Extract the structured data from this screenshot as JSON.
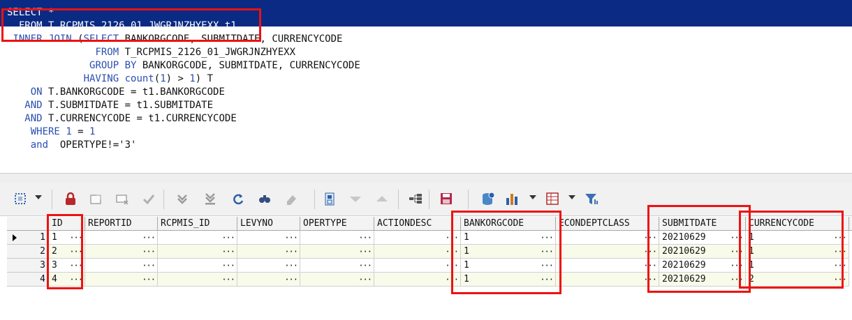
{
  "editor": {
    "lines": [
      "SELECT *",
      "  FROM T_RCPMIS_2126_01_JWGRJNZHYEXX t1",
      " INNER JOIN (SELECT BANKORGCODE, SUBMITDATE, CURRENCYCODE",
      "               FROM T_RCPMIS_2126_01_JWGRJNZHYEXX",
      "              GROUP BY BANKORGCODE, SUBMITDATE, CURRENCYCODE",
      "             HAVING count(1) > 1) T",
      "    ON T.BANKORGCODE = t1.BANKORGCODE",
      "   AND T.SUBMITDATE = t1.SUBMITDATE",
      "   AND T.CURRENCYCODE = t1.CURRENCYCODE",
      "    WHERE 1 = 1",
      "    and  OPERTYPE!='3'"
    ]
  },
  "toolbar": {
    "buttons": [
      "select-mode-icon",
      "lock-icon",
      "new-record-icon",
      "delete-record-icon",
      "post-icon",
      "next-record-icon",
      "last-record-icon",
      "refresh-icon",
      "find-icon",
      "clear-icon",
      "export-icon",
      "sort-desc-icon",
      "sort-asc-icon",
      "tree-icon",
      "save-icon",
      "db-refresh-icon",
      "chart-icon",
      "grid-layout-icon",
      "filter-icon"
    ]
  },
  "grid": {
    "columns": [
      "ID",
      "REPORTID",
      "RCPMIS_ID",
      "LEVYNO",
      "OPERTYPE",
      "ACTIONDESC",
      "BANKORGCODE",
      "ECONDEPTCLASS",
      "SUBMITDATE",
      "CURRENCYCODE",
      "C"
    ],
    "rows": [
      {
        "num": "1",
        "ID": "1",
        "BANKORGCODE": "1",
        "SUBMITDATE": "20210629",
        "CURRENCYCODE": "1"
      },
      {
        "num": "2",
        "ID": "2",
        "BANKORGCODE": "1",
        "SUBMITDATE": "20210629",
        "CURRENCYCODE": "1"
      },
      {
        "num": "3",
        "ID": "3",
        "BANKORGCODE": "1",
        "SUBMITDATE": "20210629",
        "CURRENCYCODE": "1"
      },
      {
        "num": "4",
        "ID": "4",
        "BANKORGCODE": "1",
        "SUBMITDATE": "20210629",
        "CURRENCYCODE": "2"
      }
    ]
  },
  "colors": {
    "selection": "#0a2a84",
    "keyword": "#2a4fb0",
    "annotation": "#ee1111",
    "rowAlt": "#f8fbea"
  }
}
